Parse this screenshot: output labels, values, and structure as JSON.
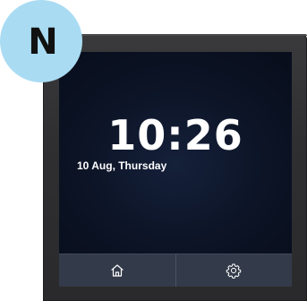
{
  "badge": {
    "letter": "N",
    "color": "#a9dcf3"
  },
  "clock": {
    "time": "10:26",
    "date": "10 Aug, Thursday"
  },
  "bottom_bar": {
    "buttons": [
      {
        "icon": "home-icon"
      },
      {
        "icon": "gear-icon"
      }
    ]
  },
  "colors": {
    "screen_background": "#0c1426",
    "bottom_bar": "#333a49",
    "bezel": "#2f2f31",
    "text": "#ffffff"
  }
}
